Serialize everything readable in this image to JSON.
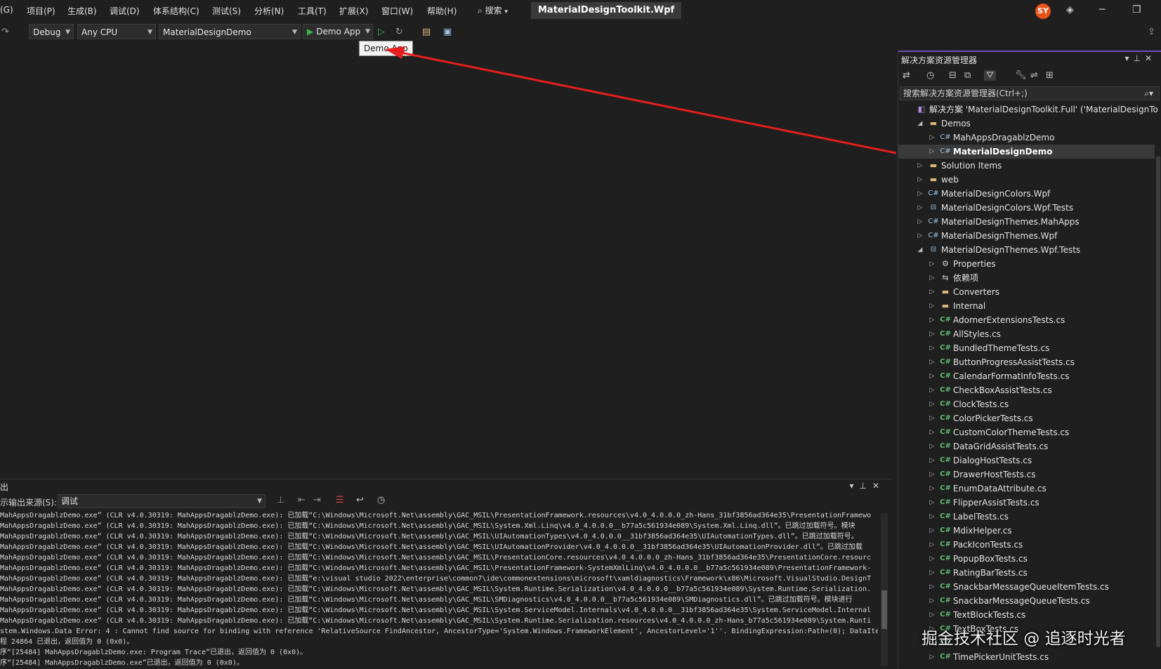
{
  "menubar": {
    "items": [
      "(G)",
      "项目(P)",
      "生成(B)",
      "调试(D)",
      "体系结构(C)",
      "测试(S)",
      "分析(N)",
      "工具(T)",
      "扩展(X)",
      "窗口(W)",
      "帮助(H)"
    ],
    "search_label": "搜索",
    "window_title": "MaterialDesignToolkit.Wpf",
    "avatar_initials": "SY"
  },
  "toolbar": {
    "config": "Debug",
    "platform": "Any CPU",
    "startup_project": "MaterialDesignDemo",
    "run_label": "Demo App",
    "tooltip": "Demo App"
  },
  "solution_explorer": {
    "title": "解决方案资源管理器",
    "search_placeholder": "搜索解决方案资源管理器(Ctrl+;)",
    "tree": [
      {
        "label": "解决方案 'MaterialDesignToolkit.Full' ('MaterialDesignTo",
        "icon": "solution-icon",
        "level": 0,
        "expander": ""
      },
      {
        "label": "Demos",
        "icon": "folder-icon",
        "level": 1,
        "expander": "expanded"
      },
      {
        "label": "MahAppsDragablzDemo",
        "icon": "csproj-icon",
        "level": 2,
        "expander": "collapsed"
      },
      {
        "label": "MaterialDesignDemo",
        "icon": "csproj-icon",
        "level": 2,
        "expander": "collapsed",
        "selected": true
      },
      {
        "label": "Solution Items",
        "icon": "folder-icon",
        "level": 1,
        "expander": "collapsed"
      },
      {
        "label": "web",
        "icon": "folder-icon",
        "level": 1,
        "expander": "collapsed"
      },
      {
        "label": "MaterialDesignColors.Wpf",
        "icon": "csproj-icon",
        "level": 1,
        "expander": "collapsed"
      },
      {
        "label": "MaterialDesignColors.Wpf.Tests",
        "icon": "testproj-icon",
        "level": 1,
        "expander": "collapsed"
      },
      {
        "label": "MaterialDesignThemes.MahApps",
        "icon": "csproj-icon",
        "level": 1,
        "expander": "collapsed"
      },
      {
        "label": "MaterialDesignThemes.Wpf",
        "icon": "csproj-icon",
        "level": 1,
        "expander": "collapsed"
      },
      {
        "label": "MaterialDesignThemes.Wpf.Tests",
        "icon": "testproj-icon",
        "level": 1,
        "expander": "expanded"
      },
      {
        "label": "Properties",
        "icon": "properties-icon",
        "level": 2,
        "expander": "collapsed"
      },
      {
        "label": "依赖项",
        "icon": "dependencies-icon",
        "level": 2,
        "expander": "collapsed"
      },
      {
        "label": "Converters",
        "icon": "folder-icon",
        "level": 2,
        "expander": "collapsed"
      },
      {
        "label": "Internal",
        "icon": "folder-icon",
        "level": 2,
        "expander": "collapsed"
      },
      {
        "label": "AdornerExtensionsTests.cs",
        "icon": "csharp-file-icon",
        "level": 2,
        "expander": "collapsed"
      },
      {
        "label": "AllStyles.cs",
        "icon": "csharp-file-icon",
        "level": 2,
        "expander": "collapsed"
      },
      {
        "label": "BundledThemeTests.cs",
        "icon": "csharp-file-icon",
        "level": 2,
        "expander": "collapsed"
      },
      {
        "label": "ButtonProgressAssistTests.cs",
        "icon": "csharp-file-icon",
        "level": 2,
        "expander": "collapsed"
      },
      {
        "label": "CalendarFormatInfoTests.cs",
        "icon": "csharp-file-icon",
        "level": 2,
        "expander": "collapsed"
      },
      {
        "label": "CheckBoxAssistTests.cs",
        "icon": "csharp-file-icon",
        "level": 2,
        "expander": "collapsed"
      },
      {
        "label": "ClockTests.cs",
        "icon": "csharp-file-icon",
        "level": 2,
        "expander": "collapsed"
      },
      {
        "label": "ColorPickerTests.cs",
        "icon": "csharp-file-icon",
        "level": 2,
        "expander": "collapsed"
      },
      {
        "label": "CustomColorThemeTests.cs",
        "icon": "csharp-file-icon",
        "level": 2,
        "expander": "collapsed"
      },
      {
        "label": "DataGridAssistTests.cs",
        "icon": "csharp-file-icon",
        "level": 2,
        "expander": "collapsed"
      },
      {
        "label": "DialogHostTests.cs",
        "icon": "csharp-file-icon",
        "level": 2,
        "expander": "collapsed"
      },
      {
        "label": "DrawerHostTests.cs",
        "icon": "csharp-file-icon",
        "level": 2,
        "expander": "collapsed"
      },
      {
        "label": "EnumDataAttribute.cs",
        "icon": "csharp-file-icon",
        "level": 2,
        "expander": "collapsed"
      },
      {
        "label": "FlipperAssistTests.cs",
        "icon": "csharp-file-icon",
        "level": 2,
        "expander": "collapsed"
      },
      {
        "label": "LabelTests.cs",
        "icon": "csharp-file-icon",
        "level": 2,
        "expander": "collapsed"
      },
      {
        "label": "MdixHelper.cs",
        "icon": "csharp-file-icon",
        "level": 2,
        "expander": "collapsed"
      },
      {
        "label": "PackIconTests.cs",
        "icon": "csharp-file-icon",
        "level": 2,
        "expander": "collapsed"
      },
      {
        "label": "PopupBoxTests.cs",
        "icon": "csharp-file-icon",
        "level": 2,
        "expander": "collapsed"
      },
      {
        "label": "RatingBarTests.cs",
        "icon": "csharp-file-icon",
        "level": 2,
        "expander": "collapsed"
      },
      {
        "label": "SnackbarMessageQueueItemTests.cs",
        "icon": "csharp-file-icon",
        "level": 2,
        "expander": "collapsed"
      },
      {
        "label": "SnackbarMessageQueueTests.cs",
        "icon": "csharp-file-icon",
        "level": 2,
        "expander": "collapsed"
      },
      {
        "label": "TextBlockTests.cs",
        "icon": "csharp-file-icon",
        "level": 2,
        "expander": "collapsed"
      },
      {
        "label": "TextBoxTests.cs",
        "icon": "csharp-file-icon",
        "level": 2,
        "expander": "collapsed"
      },
      {
        "label": "",
        "icon": "csharp-file-icon",
        "level": 2,
        "expander": "collapsed"
      },
      {
        "label": "TimePickerUnitTests.cs",
        "icon": "csharp-file-icon",
        "level": 2,
        "expander": "collapsed"
      }
    ]
  },
  "output": {
    "title": "出",
    "source_label": "示输出来源(S):",
    "source_value": "调试",
    "lines": [
      "MahAppsDragablzDemo.exe” (CLR v4.0.30319: MahAppsDragablzDemo.exe): 已加载“C:\\Windows\\Microsoft.Net\\assembly\\GAC_MSIL\\PresentationFramework.resources\\v4.0_4.0.0.0_zh-Hans_31bf3856ad364e35\\PresentationFramewo",
      "MahAppsDragablzDemo.exe” (CLR v4.0.30319: MahAppsDragablzDemo.exe): 已加载“C:\\Windows\\Microsoft.Net\\assembly\\GAC_MSIL\\System.Xml.Linq\\v4.0_4.0.0.0__b77a5c561934e089\\System.Xml.Linq.dll”。已跳过加载符号。模块",
      "MahAppsDragablzDemo.exe” (CLR v4.0.30319: MahAppsDragablzDemo.exe): 已加载“C:\\Windows\\Microsoft.Net\\assembly\\GAC_MSIL\\UIAutomationTypes\\v4.0_4.0.0.0__31bf3856ad364e35\\UIAutomationTypes.dll”。已跳过加载符号。",
      "MahAppsDragablzDemo.exe” (CLR v4.0.30319: MahAppsDragablzDemo.exe): 已加载“C:\\Windows\\Microsoft.Net\\assembly\\GAC_MSIL\\UIAutomationProvider\\v4.0_4.0.0.0__31bf3856ad364e35\\UIAutomationProvider.dll”。已跳过加载",
      "MahAppsDragablzDemo.exe” (CLR v4.0.30319: MahAppsDragablzDemo.exe): 已加载“C:\\Windows\\Microsoft.Net\\assembly\\GAC_MSIL\\PresentationCore.resources\\v4.0_4.0.0.0_zh-Hans_31bf3856ad364e35\\PresentationCore.resourc",
      "MahAppsDragablzDemo.exe” (CLR v4.0.30319: MahAppsDragablzDemo.exe): 已加载“C:\\Windows\\Microsoft.Net\\assembly\\GAC_MSIL\\PresentationFramework-SystemXmlLinq\\v4.0_4.0.0.0__b77a5c561934e089\\PresentationFramework-",
      "MahAppsDragablzDemo.exe” (CLR v4.0.30319: MahAppsDragablzDemo.exe): 已加载“e:\\visual studio 2022\\enterprise\\common7\\ide\\commonextensions\\microsoft\\xamldiagnostics\\Framework\\x86\\Microsoft.VisualStudio.DesignT",
      "MahAppsDragablzDemo.exe” (CLR v4.0.30319: MahAppsDragablzDemo.exe): 已加载“C:\\Windows\\Microsoft.Net\\assembly\\GAC_MSIL\\System.Runtime.Serialization\\v4.0_4.0.0.0__b77a5c561934e089\\System.Runtime.Serialization.",
      "MahAppsDragablzDemo.exe” (CLR v4.0.30319: MahAppsDragablzDemo.exe): 已加载“C:\\Windows\\Microsoft.Net\\assembly\\GAC_MSIL\\SMDiagnostics\\v4.0_4.0.0.0__b77a5c561934e089\\SMDiagnostics.dll”。已跳过加载符号。模块进行",
      "MahAppsDragablzDemo.exe” (CLR v4.0.30319: MahAppsDragablzDemo.exe): 已加载“C:\\Windows\\Microsoft.Net\\assembly\\GAC_MSIL\\System.ServiceModel.Internals\\v4.0_4.0.0.0__31bf3856ad364e35\\System.ServiceModel.Internal",
      "MahAppsDragablzDemo.exe” (CLR v4.0.30319: MahAppsDragablzDemo.exe): 已加载“C:\\Windows\\Microsoft.Net\\assembly\\GAC_MSIL\\System.Runtime.Serialization.resources\\v4.0_4.0.0.0_zh-Hans_b77a5c561934e089\\System.Runti",
      "stem.Windows.Data Error: 4 : Cannot find source for binding with reference 'RelativeSource FindAncestor, AncestorType='System.Windows.FrameworkElement', AncestorLevel='1''. BindingExpression:Path=(0); DataIte",
      "程 24864 已退出，返回值为 0 (0x0)。",
      "序“[25484] MahAppsDragablzDemo.exe: Program Trace”已退出，返回值为 0 (0x0)。",
      "序“[25484] MahAppsDragablzDemo.exe”已退出，返回值为 0 (0x0)。"
    ]
  },
  "watermark": "掘金技术社区 @ 追逐时光者",
  "colors": {
    "accent": "#6b4fbb",
    "run_green": "#3bb54a",
    "arrow_red": "#e81e1e",
    "avatar": "#e8531a"
  }
}
